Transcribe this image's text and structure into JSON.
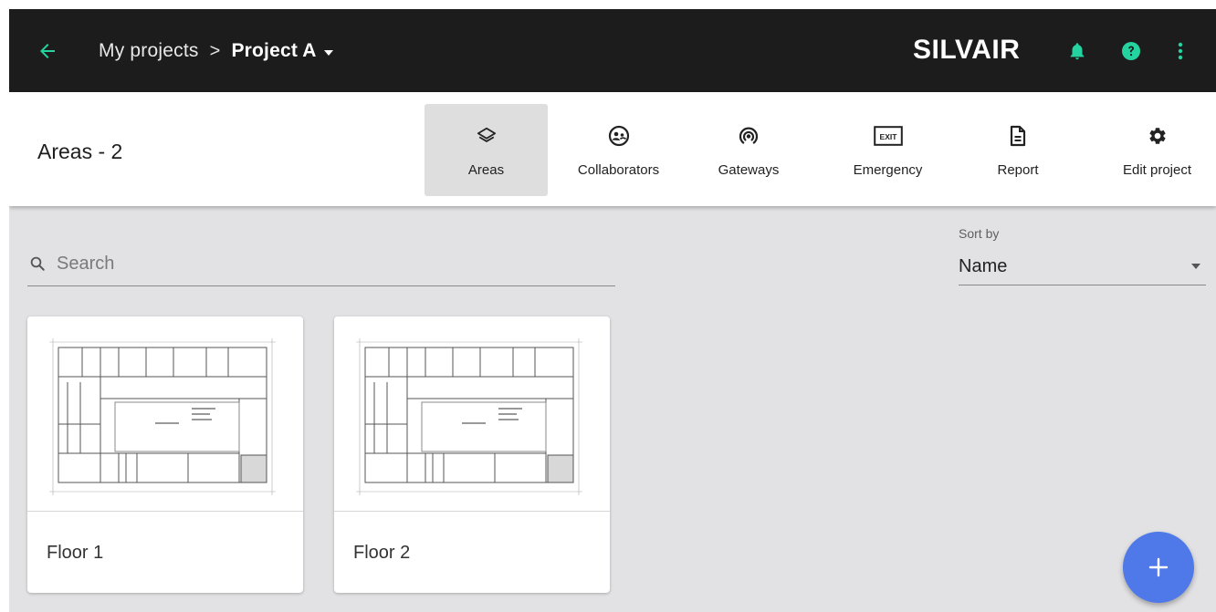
{
  "header": {
    "breadcrumb_parent": "My projects",
    "breadcrumb_separator": ">",
    "project_name": "Project A",
    "brand": "SILVAIR"
  },
  "colors": {
    "accent": "#25d3a0",
    "topbar": "#1c1c1c",
    "fab": "#4f79e8",
    "content_bg": "#e2e2e4"
  },
  "toolbar": {
    "title": "Areas - 2",
    "items": [
      {
        "label": "Areas",
        "icon": "layers-icon",
        "active": true
      },
      {
        "label": "Collaborators",
        "icon": "collaborators-icon",
        "active": false
      },
      {
        "label": "Gateways",
        "icon": "gateway-icon",
        "active": false
      },
      {
        "label": "Emergency",
        "icon": "exit-sign-icon",
        "active": false
      },
      {
        "label": "Report",
        "icon": "report-icon",
        "active": false
      },
      {
        "label": "Edit project",
        "icon": "gear-icon",
        "active": false
      }
    ],
    "exit_sign_text": "EXIT"
  },
  "filters": {
    "search_placeholder": "Search",
    "sort_label": "Sort by",
    "sort_value": "Name"
  },
  "areas": [
    {
      "name": "Floor 1"
    },
    {
      "name": "Floor 2"
    }
  ],
  "fab": {
    "label": "+",
    "icon": "add-icon"
  }
}
